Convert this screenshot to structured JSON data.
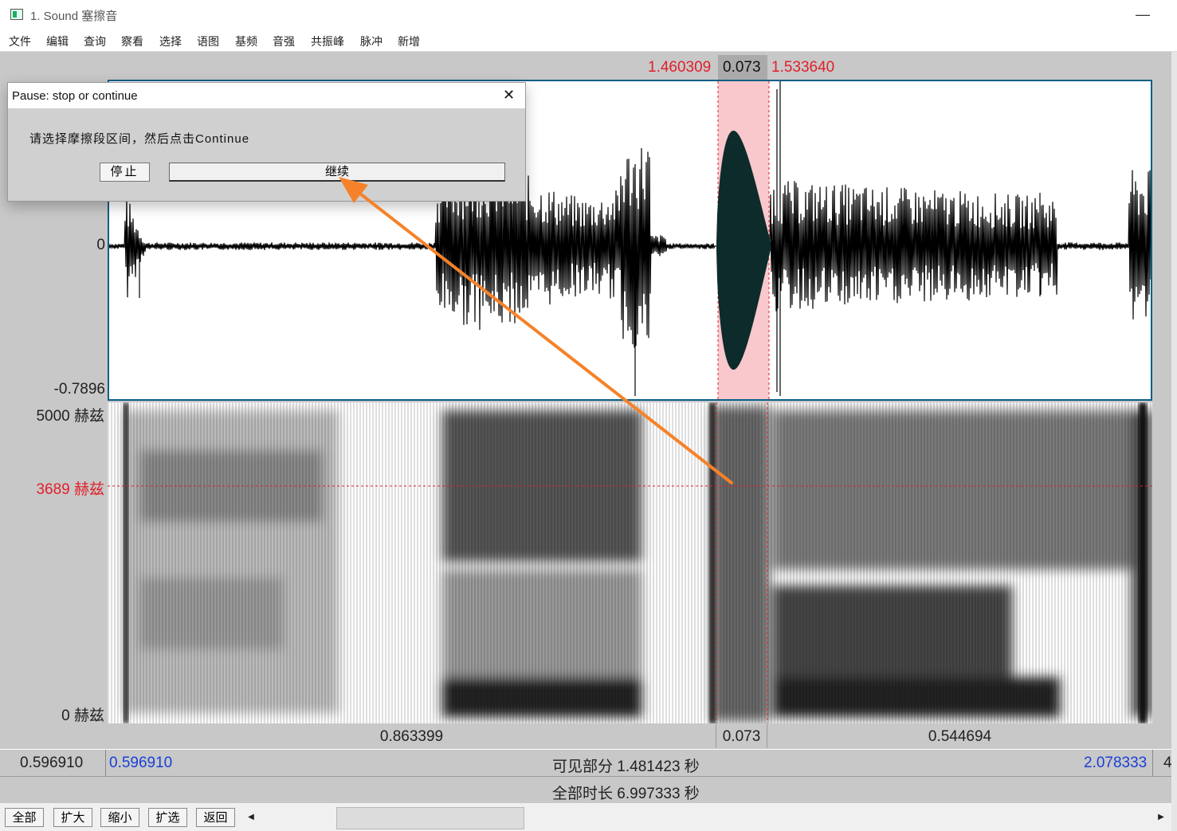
{
  "window": {
    "title": "1. Sound 塞擦音",
    "minimize": "—"
  },
  "menu": [
    "文件",
    "编辑",
    "查询",
    "察看",
    "选择",
    "语图",
    "基频",
    "音强",
    "共振峰",
    "脉冲",
    "新增"
  ],
  "selection": {
    "start": "1.460309",
    "duration": "0.073",
    "end": "1.533640"
  },
  "waveform": {
    "ymin": "-0.7896",
    "zero": "0"
  },
  "spectrogram": {
    "top": "5000 赫兹",
    "cursor": "3689 赫兹",
    "bottom": "0 赫兹"
  },
  "durations": {
    "left": "0.863399",
    "selection": "0.073",
    "right": "0.544694"
  },
  "visible": {
    "outer_left": "0.596910",
    "start": "0.596910",
    "label": "可见部分 1.481423 秒",
    "end": "2.078333",
    "outer_right": "4"
  },
  "total": {
    "label": "全部时长 6.997333 秒"
  },
  "buttons": [
    "全部",
    "扩大",
    "缩小",
    "扩选",
    "返回"
  ],
  "scroll": {
    "left": "◀",
    "right": "▶"
  },
  "dialog": {
    "title": "Pause: stop or continue",
    "close": "✕",
    "message": "请选择摩擦段区间，然后点击Continue",
    "stop": "停止",
    "continue": "继续"
  },
  "colors": {
    "selection": "#f8c8cc",
    "cursor": "#e0202a",
    "frame": "#0b5f86",
    "arrow": "#f5822a"
  }
}
